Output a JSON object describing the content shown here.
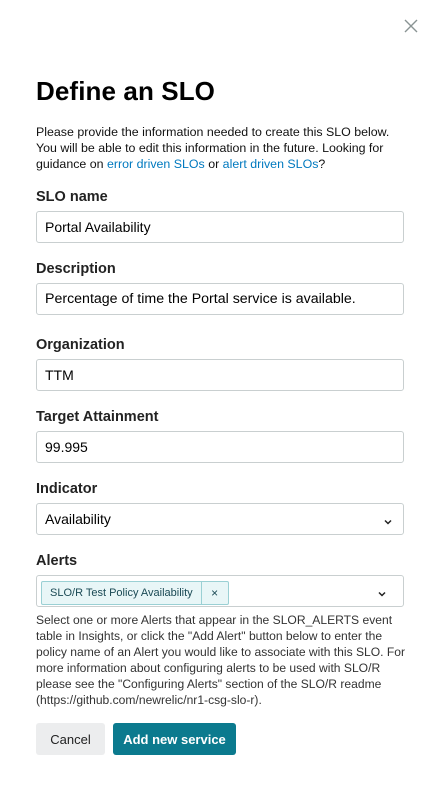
{
  "dialog": {
    "title": "Define an SLO",
    "intro_text": "Please provide the information needed to create this SLO below. You will be able to edit this information in the future. Looking for guidance on ",
    "intro_link1": "error driven SLOs",
    "intro_mid": " or ",
    "intro_link2": "alert driven SLOs",
    "intro_end": "?"
  },
  "fields": {
    "slo_name": {
      "label": "SLO name",
      "value": "Portal Availability"
    },
    "description": {
      "label": "Description",
      "value": "Percentage of time the Portal service is available."
    },
    "organization": {
      "label": "Organization",
      "value": "TTM"
    },
    "target": {
      "label": "Target Attainment",
      "value": "99.995"
    },
    "indicator": {
      "label": "Indicator",
      "value": "Availability"
    },
    "alerts": {
      "label": "Alerts",
      "tags": [
        "SLO/R Test Policy Availability"
      ],
      "remove_glyph": "×",
      "help": "Select one or more Alerts that appear in the SLOR_ALERTS event table in Insights, or click the \"Add Alert\" button below to enter the policy name of an Alert you would like to associate with this SLO. For more information about configuring alerts to be used with SLO/R please see the \"Configuring Alerts\" section of the SLO/R readme (https://github.com/newrelic/nr1-csg-slo-r)."
    }
  },
  "buttons": {
    "cancel": "Cancel",
    "add": "Add new service"
  },
  "colors": {
    "primary": "#0b7a8e",
    "link": "#0079bf",
    "tag_bg": "#e8f6f7"
  }
}
